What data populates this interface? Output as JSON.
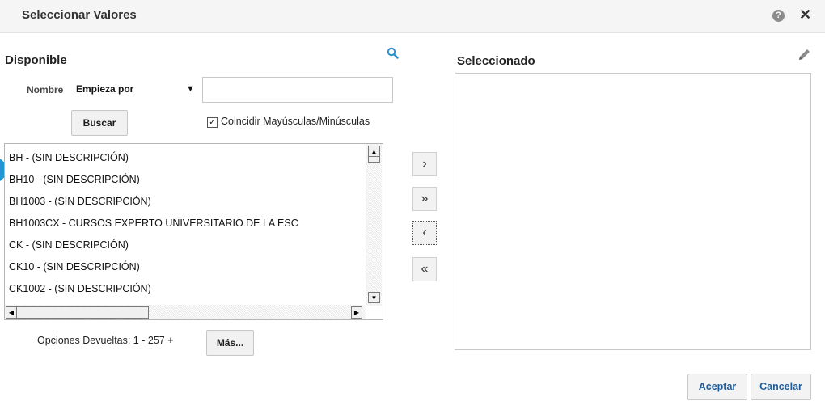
{
  "dialog": {
    "title": "Seleccionar Valores",
    "help_label": "?",
    "close_label": "✕"
  },
  "available": {
    "heading": "Disponible",
    "name_label": "Nombre",
    "match_mode": "Empieza por",
    "search_value": "",
    "search_button": "Buscar",
    "case_match_label": "Coincidir Mayúsculas/Minúsculas",
    "case_match_checked": true,
    "items": [
      "BH - (SIN DESCRIPCIÓN)",
      "BH10 - (SIN DESCRIPCIÓN)",
      "BH1003 - (SIN DESCRIPCIÓN)",
      "BH1003CX - CURSOS EXPERTO UNIVERSITARIO DE LA ESC",
      "CK - (SIN DESCRIPCIÓN)",
      "CK10 - (SIN DESCRIPCIÓN)",
      "CK1002 - (SIN DESCRIPCIÓN)"
    ],
    "results_label": "Opciones Devueltas: 1 - 257 +",
    "more_button": "Más..."
  },
  "move_buttons": {
    "move": "›",
    "move_all": "»",
    "remove": "‹",
    "remove_all": "«"
  },
  "selected": {
    "heading": "Seleccionado"
  },
  "footer": {
    "accept": "Aceptar",
    "cancel": "Cancelar"
  },
  "icons": {
    "search": "search-icon",
    "edit": "pencil-icon",
    "help": "help-icon",
    "close": "close-icon"
  },
  "colors": {
    "accent": "#2196d3",
    "footer_text": "#1f5d9a"
  }
}
